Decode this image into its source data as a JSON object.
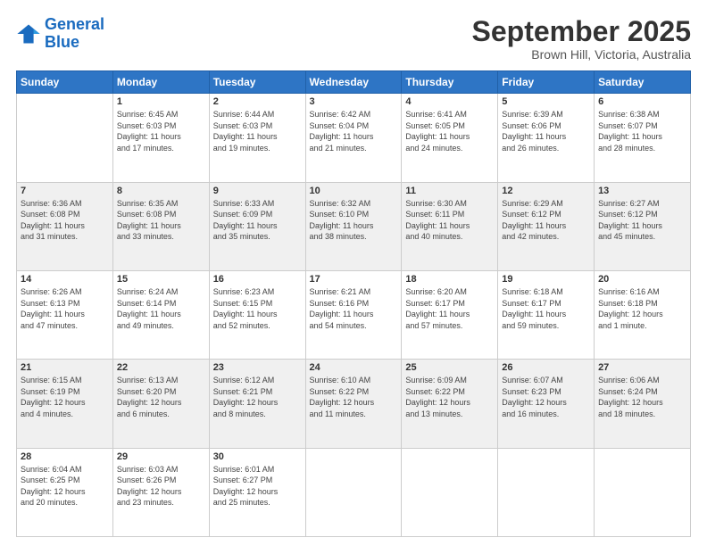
{
  "logo": {
    "line1": "General",
    "line2": "Blue"
  },
  "header": {
    "month": "September 2025",
    "location": "Brown Hill, Victoria, Australia"
  },
  "days_of_week": [
    "Sunday",
    "Monday",
    "Tuesday",
    "Wednesday",
    "Thursday",
    "Friday",
    "Saturday"
  ],
  "weeks": [
    [
      {
        "day": "",
        "info": ""
      },
      {
        "day": "1",
        "info": "Sunrise: 6:45 AM\nSunset: 6:03 PM\nDaylight: 11 hours\nand 17 minutes."
      },
      {
        "day": "2",
        "info": "Sunrise: 6:44 AM\nSunset: 6:03 PM\nDaylight: 11 hours\nand 19 minutes."
      },
      {
        "day": "3",
        "info": "Sunrise: 6:42 AM\nSunset: 6:04 PM\nDaylight: 11 hours\nand 21 minutes."
      },
      {
        "day": "4",
        "info": "Sunrise: 6:41 AM\nSunset: 6:05 PM\nDaylight: 11 hours\nand 24 minutes."
      },
      {
        "day": "5",
        "info": "Sunrise: 6:39 AM\nSunset: 6:06 PM\nDaylight: 11 hours\nand 26 minutes."
      },
      {
        "day": "6",
        "info": "Sunrise: 6:38 AM\nSunset: 6:07 PM\nDaylight: 11 hours\nand 28 minutes."
      }
    ],
    [
      {
        "day": "7",
        "info": "Sunrise: 6:36 AM\nSunset: 6:08 PM\nDaylight: 11 hours\nand 31 minutes."
      },
      {
        "day": "8",
        "info": "Sunrise: 6:35 AM\nSunset: 6:08 PM\nDaylight: 11 hours\nand 33 minutes."
      },
      {
        "day": "9",
        "info": "Sunrise: 6:33 AM\nSunset: 6:09 PM\nDaylight: 11 hours\nand 35 minutes."
      },
      {
        "day": "10",
        "info": "Sunrise: 6:32 AM\nSunset: 6:10 PM\nDaylight: 11 hours\nand 38 minutes."
      },
      {
        "day": "11",
        "info": "Sunrise: 6:30 AM\nSunset: 6:11 PM\nDaylight: 11 hours\nand 40 minutes."
      },
      {
        "day": "12",
        "info": "Sunrise: 6:29 AM\nSunset: 6:12 PM\nDaylight: 11 hours\nand 42 minutes."
      },
      {
        "day": "13",
        "info": "Sunrise: 6:27 AM\nSunset: 6:12 PM\nDaylight: 11 hours\nand 45 minutes."
      }
    ],
    [
      {
        "day": "14",
        "info": "Sunrise: 6:26 AM\nSunset: 6:13 PM\nDaylight: 11 hours\nand 47 minutes."
      },
      {
        "day": "15",
        "info": "Sunrise: 6:24 AM\nSunset: 6:14 PM\nDaylight: 11 hours\nand 49 minutes."
      },
      {
        "day": "16",
        "info": "Sunrise: 6:23 AM\nSunset: 6:15 PM\nDaylight: 11 hours\nand 52 minutes."
      },
      {
        "day": "17",
        "info": "Sunrise: 6:21 AM\nSunset: 6:16 PM\nDaylight: 11 hours\nand 54 minutes."
      },
      {
        "day": "18",
        "info": "Sunrise: 6:20 AM\nSunset: 6:17 PM\nDaylight: 11 hours\nand 57 minutes."
      },
      {
        "day": "19",
        "info": "Sunrise: 6:18 AM\nSunset: 6:17 PM\nDaylight: 11 hours\nand 59 minutes."
      },
      {
        "day": "20",
        "info": "Sunrise: 6:16 AM\nSunset: 6:18 PM\nDaylight: 12 hours\nand 1 minute."
      }
    ],
    [
      {
        "day": "21",
        "info": "Sunrise: 6:15 AM\nSunset: 6:19 PM\nDaylight: 12 hours\nand 4 minutes."
      },
      {
        "day": "22",
        "info": "Sunrise: 6:13 AM\nSunset: 6:20 PM\nDaylight: 12 hours\nand 6 minutes."
      },
      {
        "day": "23",
        "info": "Sunrise: 6:12 AM\nSunset: 6:21 PM\nDaylight: 12 hours\nand 8 minutes."
      },
      {
        "day": "24",
        "info": "Sunrise: 6:10 AM\nSunset: 6:22 PM\nDaylight: 12 hours\nand 11 minutes."
      },
      {
        "day": "25",
        "info": "Sunrise: 6:09 AM\nSunset: 6:22 PM\nDaylight: 12 hours\nand 13 minutes."
      },
      {
        "day": "26",
        "info": "Sunrise: 6:07 AM\nSunset: 6:23 PM\nDaylight: 12 hours\nand 16 minutes."
      },
      {
        "day": "27",
        "info": "Sunrise: 6:06 AM\nSunset: 6:24 PM\nDaylight: 12 hours\nand 18 minutes."
      }
    ],
    [
      {
        "day": "28",
        "info": "Sunrise: 6:04 AM\nSunset: 6:25 PM\nDaylight: 12 hours\nand 20 minutes."
      },
      {
        "day": "29",
        "info": "Sunrise: 6:03 AM\nSunset: 6:26 PM\nDaylight: 12 hours\nand 23 minutes."
      },
      {
        "day": "30",
        "info": "Sunrise: 6:01 AM\nSunset: 6:27 PM\nDaylight: 12 hours\nand 25 minutes."
      },
      {
        "day": "",
        "info": ""
      },
      {
        "day": "",
        "info": ""
      },
      {
        "day": "",
        "info": ""
      },
      {
        "day": "",
        "info": ""
      }
    ]
  ]
}
